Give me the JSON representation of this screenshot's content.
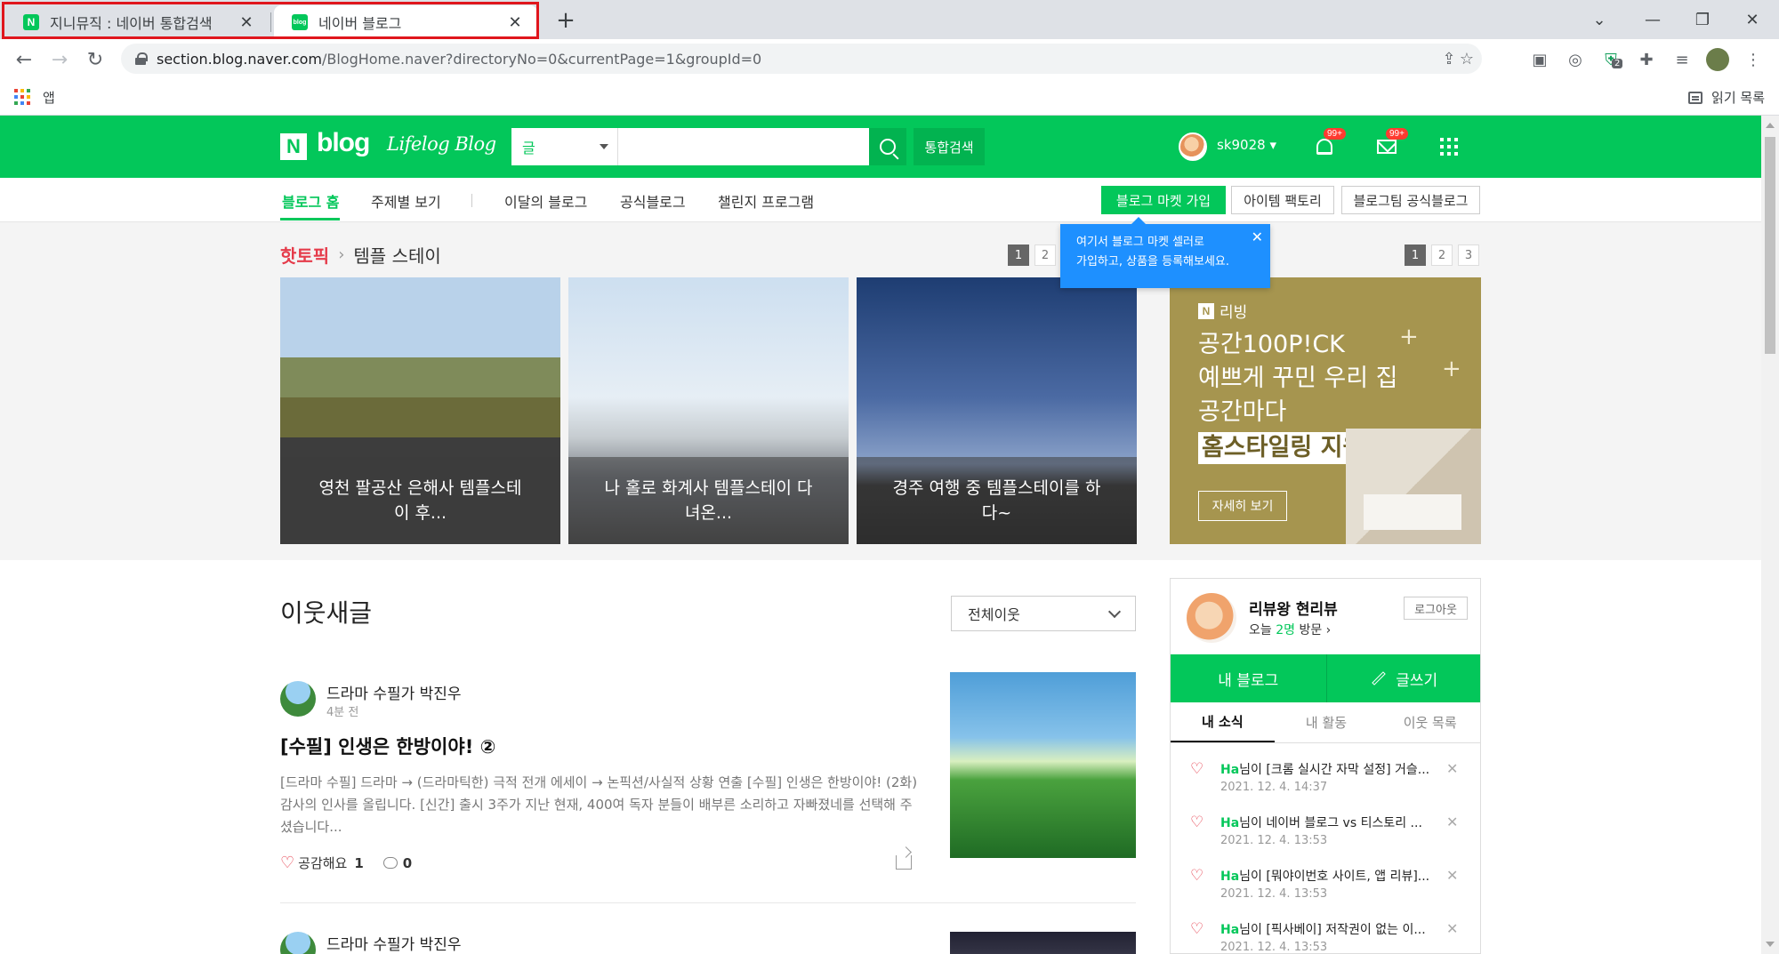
{
  "browser": {
    "tabs": [
      {
        "favicon": "N",
        "title": "지니뮤직 : 네이버 통합검색"
      },
      {
        "favicon": "blog",
        "title": "네이버 블로그"
      }
    ],
    "url_host": "section.blog.naver.com",
    "url_path": "/BlogHome.naver?directoryNo=0&currentPage=1&groupId=0",
    "extension_badge": "2",
    "bookmarks_apps_label": "앱",
    "reading_list_label": "읽기 목록"
  },
  "header": {
    "logo_letter": "N",
    "logo_text": "blog",
    "lifelog_text": "Lifelog Blog",
    "search_type": "글",
    "search_value": "",
    "total_search_label": "통합검색",
    "username": "sk9028 ▾",
    "notif_badge": "99+",
    "mail_badge": "99+"
  },
  "subnav": {
    "items": [
      "블로그 홈",
      "주제별 보기",
      "이달의 블로그",
      "공식블로그",
      "챌린지 프로그램"
    ],
    "buttons": [
      "블로그 마켓 가입",
      "아이템 팩토리",
      "블로그팀 공식블로그"
    ]
  },
  "tooltip": {
    "line1": "여기서 블로그 마켓 셀러로",
    "line2": "가입하고, 상품을 등록해보세요."
  },
  "hot_topic": {
    "label": "핫토픽",
    "topic": "템플 스테이",
    "pager": [
      "1",
      "2"
    ],
    "cards": [
      {
        "caption": "영천 팔공산 은해사 템플스테이 후..."
      },
      {
        "caption": "나 홀로 화계사 템플스테이 다녀온..."
      },
      {
        "caption": "경주 여행 중 템플스테이를 하다~"
      }
    ]
  },
  "ad": {
    "pager": [
      "1",
      "2",
      "3"
    ],
    "brand": "리빙",
    "line1": "공간100P!CK",
    "line2": "예쁘게 꾸민 우리 집",
    "line3": "공간마다",
    "highlight": "홈스타일링 지원금",
    "button": "자세히 보기"
  },
  "neighbors": {
    "title": "이웃새글",
    "filter": "전체이웃",
    "posts": [
      {
        "author": "드라마 수필가 박진우",
        "time": "4분 전",
        "title": "[수필] 인생은 한방이야! ②",
        "body": "[드라마 수필] 드라마 → (드라마틱한) 극적 전개 에세이 → 논픽션/사실적 상황 연출 [수필] 인생은 한방이야! (2화) 감사의 인사를 올립니다. [신간] 출시 3주가 지난 현재, 400여 독자 분들이 배부른 소리하고 자빠졌네를 선택해 주셨습니다...",
        "like_label": "공감해요",
        "likes": "1",
        "comments": "0"
      },
      {
        "author": "드라마 수필가 박진우"
      }
    ]
  },
  "profile": {
    "name": "리뷰왕 현리뷰",
    "visit_prefix": "오늘",
    "visit_count": "2명",
    "visit_suffix": "방문 ›",
    "logout": "로그아웃",
    "my_blog": "내 블로그",
    "write": "글쓰기",
    "tabs": [
      "내 소식",
      "내 활동",
      "이웃 목록"
    ],
    "news": [
      {
        "who": "Ha",
        "text": "님이 [크롬 실시간 자막 설정] 거슬...",
        "date": "2021. 12. 4. 14:37"
      },
      {
        "who": "Ha",
        "text": "님이 네이버 블로그 vs 티스토리 ...",
        "date": "2021. 12. 4. 13:53"
      },
      {
        "who": "Ha",
        "text": "님이 [뭐야이번호 사이트, 앱 리뷰]...",
        "date": "2021. 12. 4. 13:53"
      },
      {
        "who": "Ha",
        "text": "님이 [픽사베이] 저작권이 없는 이...",
        "date": "2021. 12. 4. 13:53"
      }
    ]
  },
  "colors": {
    "naver_green": "#03c75a",
    "tab_highlight": "#e0161d",
    "tooltip_blue": "#1e90ff",
    "ad_gold": "#a6954f"
  }
}
